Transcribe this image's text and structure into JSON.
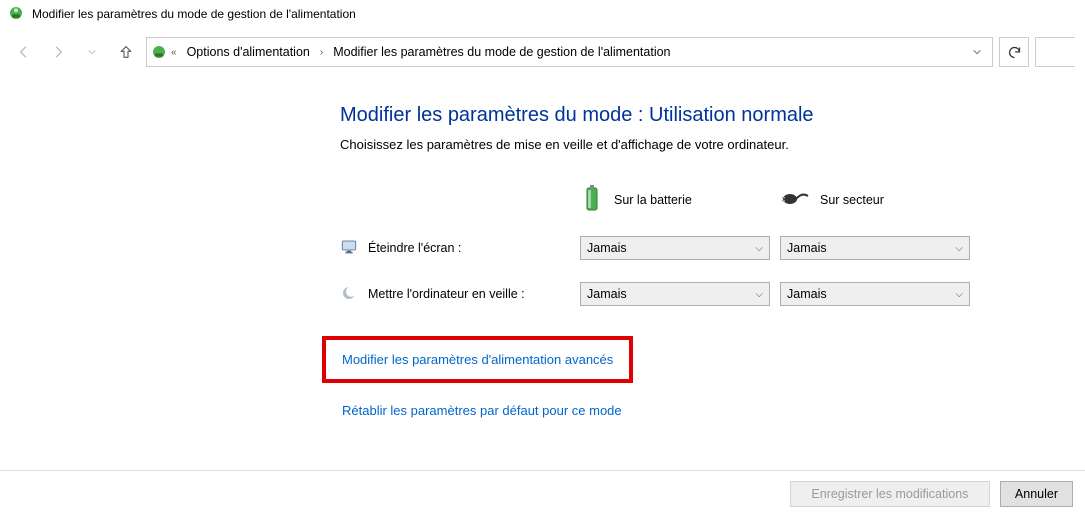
{
  "window": {
    "title": "Modifier les paramètres du mode de gestion de l'alimentation"
  },
  "breadcrumb": {
    "root": "Options d'alimentation",
    "current": "Modifier les paramètres du mode de gestion de l'alimentation"
  },
  "page": {
    "heading_prefix": "Modifier les paramètres du mode : ",
    "plan_name": "Utilisation normale",
    "subtitle": "Choisissez les paramètres de mise en veille et d'affichage de votre ordinateur."
  },
  "columns": {
    "battery": "Sur la batterie",
    "plugged": "Sur secteur"
  },
  "settings": [
    {
      "label": "Éteindre l'écran :",
      "battery_value": "Jamais",
      "plugged_value": "Jamais"
    },
    {
      "label": "Mettre l'ordinateur en veille :",
      "battery_value": "Jamais",
      "plugged_value": "Jamais"
    }
  ],
  "links": {
    "advanced": "Modifier les paramètres d'alimentation avancés",
    "restore": "Rétablir les paramètres par défaut pour ce mode"
  },
  "buttons": {
    "save": "Enregistrer les modifications",
    "cancel": "Annuler"
  }
}
